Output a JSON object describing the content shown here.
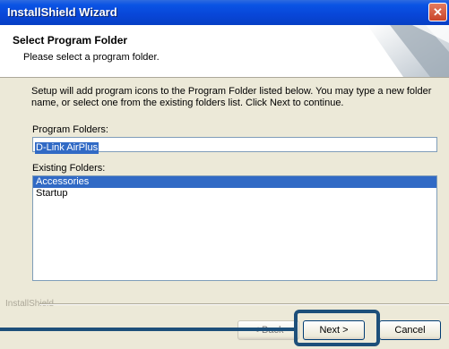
{
  "window": {
    "title": "InstallShield Wizard",
    "close_glyph": "✕"
  },
  "header": {
    "title": "Select Program Folder",
    "subtitle": "Please select a program folder."
  },
  "body": {
    "line1": "Setup will add program icons to the Program Folder listed below.  You may type a new folder",
    "line2": "name, or select one from the existing folders list.  Click Next to continue."
  },
  "program_folders": {
    "label": "Program Folders:",
    "value": "D-Link AirPlus"
  },
  "existing_folders": {
    "label": "Existing Folders:",
    "items": [
      "Accessories",
      "Startup"
    ],
    "selected_index": 0
  },
  "footer": {
    "brand": "InstallShield"
  },
  "buttons": {
    "back": "< Back",
    "next": "Next >",
    "cancel": "Cancel"
  },
  "colors": {
    "title_bar": "#0a53e4",
    "selection": "#316ac5",
    "callout": "#1d4f7a"
  }
}
